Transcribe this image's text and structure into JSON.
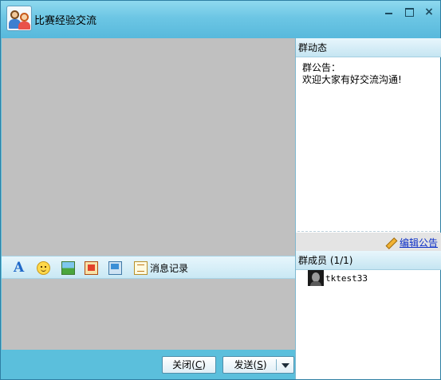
{
  "window": {
    "title": "比赛经验交流",
    "controls": {
      "minimize": "minimize",
      "maximize": "maximize",
      "close": "×"
    }
  },
  "toolbar": {
    "icons": [
      "font-icon",
      "emoji-icon",
      "image-icon",
      "screenshot-icon",
      "remote-assist-icon",
      "history-icon"
    ],
    "history_label": "消息记录"
  },
  "buttons": {
    "close_label": "关闭",
    "close_key": "C",
    "send_label": "发送",
    "send_key": "S"
  },
  "group_dynamic": {
    "header": "群动态",
    "notice_title": "群公告：",
    "notice_text": "欢迎大家有好交流沟通!",
    "edit_label": "编辑公告"
  },
  "members": {
    "header": "群成员 (1/1)",
    "list": [
      {
        "name": "tktest33"
      }
    ]
  }
}
